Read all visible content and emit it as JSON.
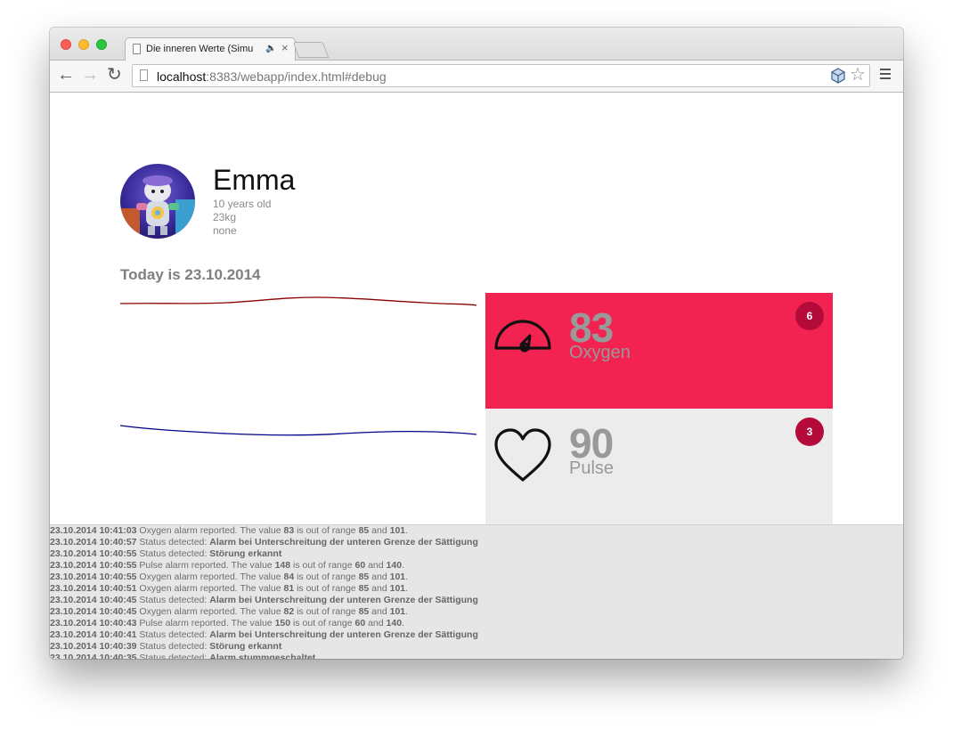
{
  "browser": {
    "tab_title": "Die inneren Werte (Simu",
    "url_host": "localhost",
    "url_rest": ":8383/webapp/index.html#debug"
  },
  "profile": {
    "name": "Emma",
    "age": "10 years old",
    "weight": "23kg",
    "note": "none"
  },
  "today_label": "Today is 23.10.2014",
  "cards": [
    {
      "value": "83",
      "label": "Oxygen",
      "badge": "6",
      "icon": "speedometer-icon",
      "color": "#f22350"
    },
    {
      "value": "90",
      "label": "Pulse",
      "badge": "3",
      "icon": "heart-icon",
      "color": "#ececec"
    }
  ],
  "sparkline_colors": {
    "oxygen": "#8b0000",
    "pulse": "#00008b"
  },
  "log": [
    {
      "time": "23.10.2014 10:41:03",
      "parts": [
        [
          "Oxygen alarm reported. The value ",
          false
        ],
        [
          "83",
          true
        ],
        [
          " is out of range ",
          false
        ],
        [
          "85",
          true
        ],
        [
          " and ",
          false
        ],
        [
          "101",
          true
        ],
        [
          ".",
          false
        ]
      ]
    },
    {
      "time": "23.10.2014 10:40:57",
      "parts": [
        [
          "Status detected: ",
          false
        ],
        [
          "Alarm bei Unterschreitung der unteren Grenze der Sättigung",
          true
        ]
      ]
    },
    {
      "time": "23.10.2014 10:40:55",
      "parts": [
        [
          "Status detected: ",
          false
        ],
        [
          "Störung erkannt",
          true
        ]
      ]
    },
    {
      "time": "23.10.2014 10:40:55",
      "parts": [
        [
          "Pulse alarm reported. The value ",
          false
        ],
        [
          "148",
          true
        ],
        [
          " is out of range ",
          false
        ],
        [
          "60",
          true
        ],
        [
          " and ",
          false
        ],
        [
          "140",
          true
        ],
        [
          ".",
          false
        ]
      ]
    },
    {
      "time": "23.10.2014 10:40:55",
      "parts": [
        [
          "Oxygen alarm reported. The value ",
          false
        ],
        [
          "84",
          true
        ],
        [
          " is out of range ",
          false
        ],
        [
          "85",
          true
        ],
        [
          " and ",
          false
        ],
        [
          "101",
          true
        ],
        [
          ".",
          false
        ]
      ]
    },
    {
      "time": "23.10.2014 10:40:51",
      "parts": [
        [
          "Oxygen alarm reported. The value ",
          false
        ],
        [
          "81",
          true
        ],
        [
          " is out of range ",
          false
        ],
        [
          "85",
          true
        ],
        [
          " and ",
          false
        ],
        [
          "101",
          true
        ],
        [
          ".",
          false
        ]
      ]
    },
    {
      "time": "23.10.2014 10:40:45",
      "parts": [
        [
          "Status detected: ",
          false
        ],
        [
          "Alarm bei Unterschreitung der unteren Grenze der Sättigung",
          true
        ]
      ]
    },
    {
      "time": "23.10.2014 10:40:45",
      "parts": [
        [
          "Oxygen alarm reported. The value ",
          false
        ],
        [
          "82",
          true
        ],
        [
          " is out of range ",
          false
        ],
        [
          "85",
          true
        ],
        [
          " and ",
          false
        ],
        [
          "101",
          true
        ],
        [
          ".",
          false
        ]
      ]
    },
    {
      "time": "23.10.2014 10:40:43",
      "parts": [
        [
          "Pulse alarm reported. The value ",
          false
        ],
        [
          "150",
          true
        ],
        [
          " is out of range ",
          false
        ],
        [
          "60",
          true
        ],
        [
          " and ",
          false
        ],
        [
          "140",
          true
        ],
        [
          ".",
          false
        ]
      ]
    },
    {
      "time": "23.10.2014 10:40:41",
      "parts": [
        [
          "Status detected: ",
          false
        ],
        [
          "Alarm bei Unterschreitung der unteren Grenze der Sättigung",
          true
        ]
      ]
    },
    {
      "time": "23.10.2014 10:40:39",
      "parts": [
        [
          "Status detected: ",
          false
        ],
        [
          "Störung erkannt",
          true
        ]
      ]
    },
    {
      "time": "23.10.2014 10:40:35",
      "parts": [
        [
          "Status detected: ",
          false
        ],
        [
          "Alarm stummgeschaltet",
          true
        ]
      ]
    }
  ]
}
